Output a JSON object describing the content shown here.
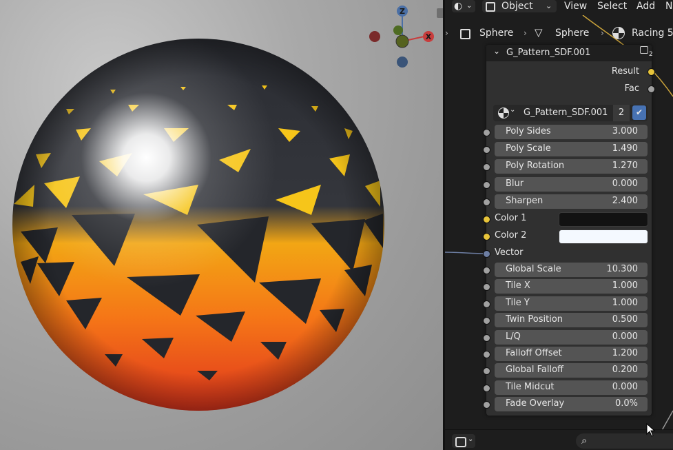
{
  "header": {
    "object_mode": "Object",
    "menu_view": "View",
    "menu_select": "Select",
    "menu_add": "Add",
    "menu_node": "No"
  },
  "breadcrumb": {
    "object": "Sphere",
    "mesh": "Sphere",
    "material": "Racing 5"
  },
  "gizmo": {
    "z": "Z",
    "x": "X"
  },
  "node": {
    "title": "G_Pattern_SDF.001",
    "users_badge": "2",
    "outputs": [
      {
        "label": "Result"
      },
      {
        "label": "Fac"
      }
    ],
    "group_selector": {
      "name": "G_Pattern_SDF.001",
      "users": "2"
    },
    "inputs": [
      {
        "label": "Poly Sides",
        "value": "3.000"
      },
      {
        "label": "Poly Scale",
        "value": "1.490"
      },
      {
        "label": "Poly Rotation",
        "value": "1.270"
      },
      {
        "label": "Blur",
        "value": "0.000"
      },
      {
        "label": "Sharpen",
        "value": "2.400"
      }
    ],
    "color1": {
      "label": "Color 1",
      "swatch": "#121212"
    },
    "color2": {
      "label": "Color 2",
      "swatch": "#f4f9ff"
    },
    "vector": {
      "label": "Vector"
    },
    "inputs2": [
      {
        "label": "Global Scale",
        "value": "10.300"
      },
      {
        "label": "Tile X",
        "value": "1.000"
      },
      {
        "label": "Tile Y",
        "value": "1.000"
      },
      {
        "label": "Twin Position",
        "value": "0.500"
      },
      {
        "label": "L/Q",
        "value": "0.000"
      },
      {
        "label": "Falloff Offset",
        "value": "1.200"
      },
      {
        "label": "Global Falloff",
        "value": "0.200"
      },
      {
        "label": "Tile Midcut",
        "value": "0.000"
      },
      {
        "label": "Fade Overlay",
        "value": "0.0%"
      }
    ]
  },
  "colors": {
    "socket_yellow": "#e7c43a",
    "socket_grey": "#a1a1a1",
    "socket_blue": "#6d7ea3",
    "axis_x": "#c83c3c",
    "axis_y": "#6a9a2b",
    "axis_z": "#4a6fa5"
  }
}
